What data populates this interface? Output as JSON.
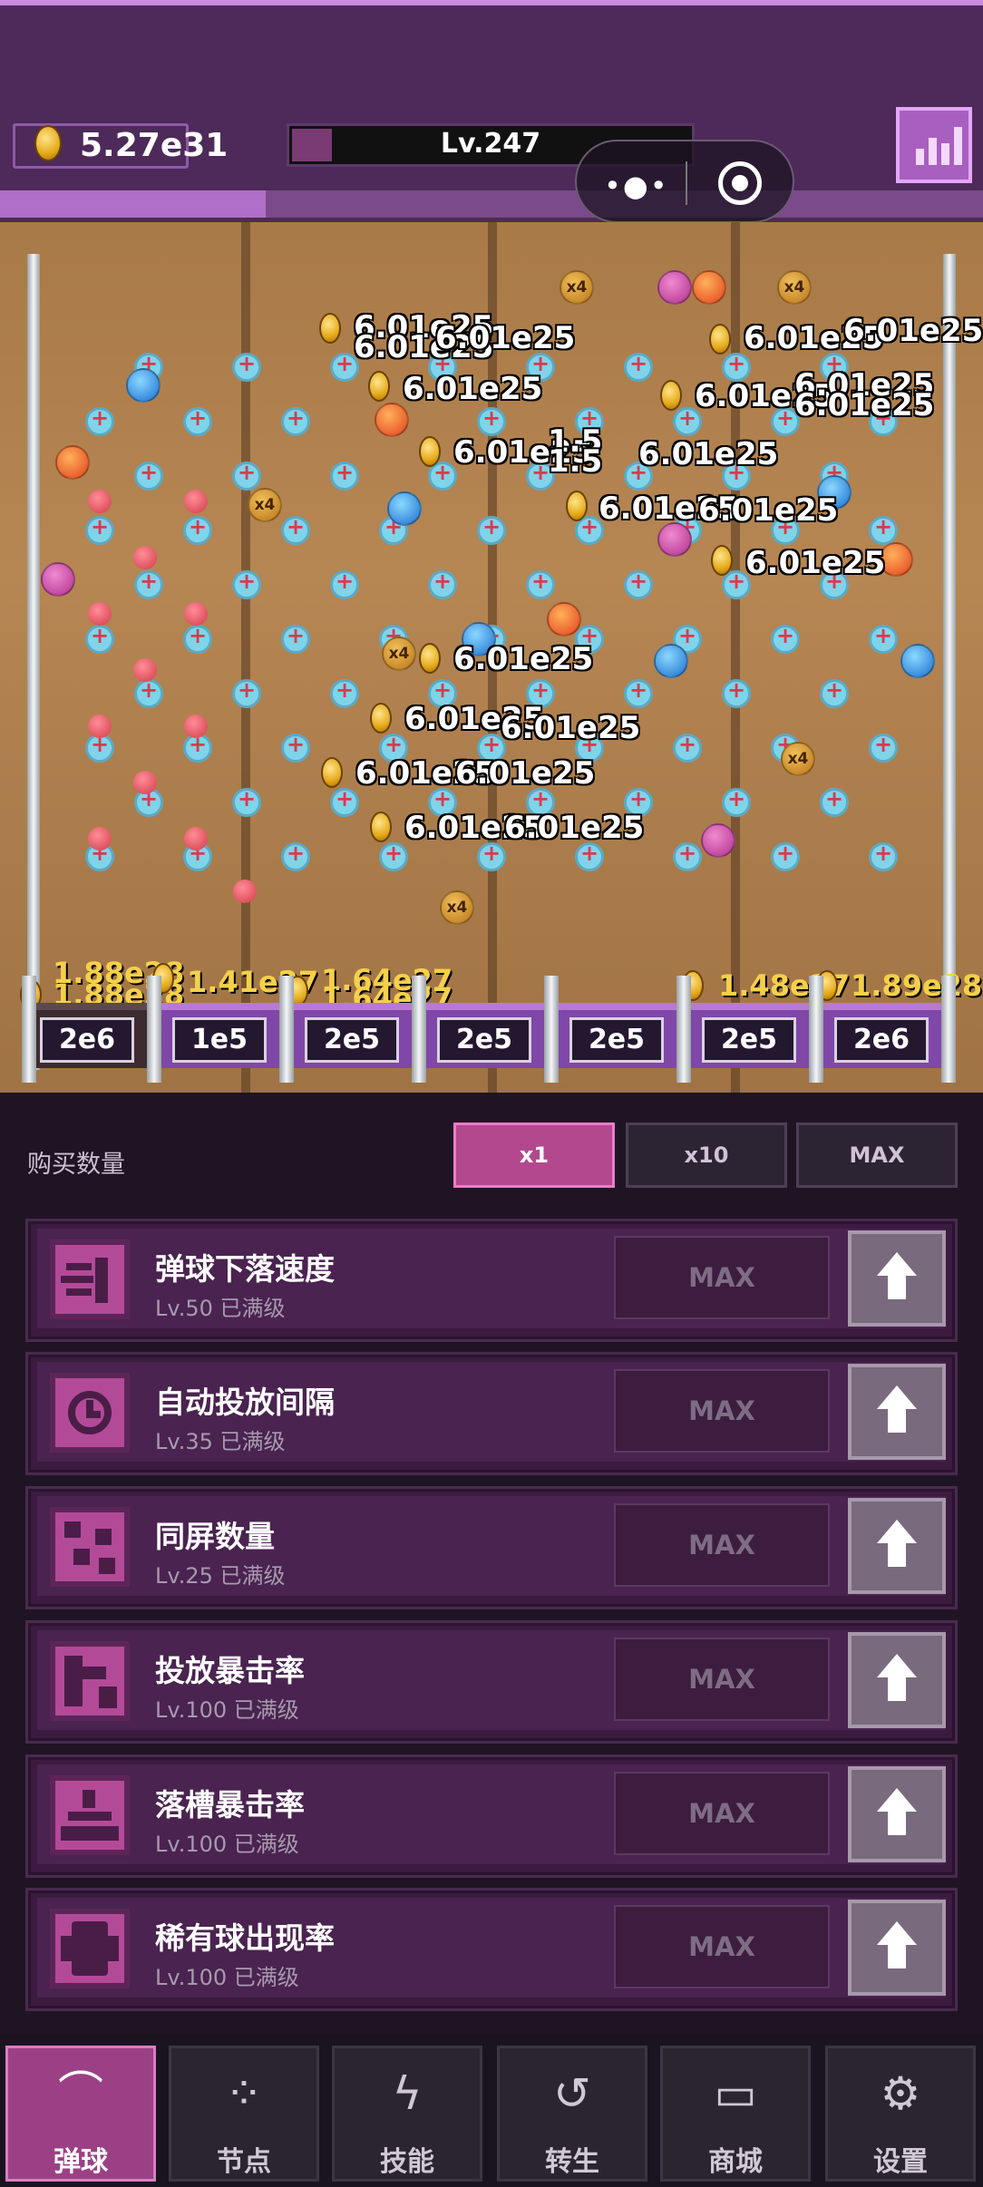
{
  "hud": {
    "coins": "5.27e31",
    "level": "Lv.247",
    "level_progress": 0.1,
    "xp_progress": 0.27
  },
  "board": {
    "popups": [
      "6.01e25",
      "6.01e25",
      "6.01e25",
      "6.01e25",
      "6.01e25",
      "6.01e25",
      "6.01e25",
      "6.01e25",
      "6.01e25",
      "6.01e25",
      "6.01e25",
      "6.01e25",
      "6.01e25",
      "6.01e25",
      "6.01e25",
      "6.01e25",
      "6.01e25",
      "6.01e25",
      "1.5",
      "1.5"
    ],
    "orb_multiplier": "x4",
    "slot_gains": [
      "1.88e28",
      "1.88e28",
      "1.41e27",
      "1.64e27",
      "1.64e27",
      "1.48e27",
      "1.89e28"
    ],
    "bins": [
      "2e6",
      "1e5",
      "2e5",
      "2e5",
      "2e5",
      "2e5",
      "2e6"
    ]
  },
  "purchase": {
    "label": "购买数量",
    "options": [
      "x1",
      "x10",
      "MAX"
    ],
    "selected": "x1"
  },
  "upgrades": [
    {
      "title": "弹球下落速度",
      "sub": "Lv.50  已满级",
      "status": "MAX"
    },
    {
      "title": "自动投放间隔",
      "sub": "Lv.35  已满级",
      "status": "MAX"
    },
    {
      "title": "同屏数量",
      "sub": "Lv.25  已满级",
      "status": "MAX"
    },
    {
      "title": "投放暴击率",
      "sub": "Lv.100  已满级",
      "status": "MAX"
    },
    {
      "title": "落槽暴击率",
      "sub": "Lv.100  已满级",
      "status": "MAX"
    },
    {
      "title": "稀有球出现率",
      "sub": "Lv.100  已满级",
      "status": "MAX"
    }
  ],
  "nav": [
    {
      "label": "弹球",
      "icon": "pinball-icon",
      "active": true
    },
    {
      "label": "节点",
      "icon": "nodes-icon"
    },
    {
      "label": "技能",
      "icon": "lightning-icon"
    },
    {
      "label": "转生",
      "icon": "rebirth-icon"
    },
    {
      "label": "商城",
      "icon": "shop-icon"
    },
    {
      "label": "设置",
      "icon": "gear-icon"
    }
  ],
  "colors": {
    "accent": "#b3488f",
    "panel": "#1f1424",
    "card": "#4a2350",
    "bin": "#7f47a8",
    "gain_text": "#f5d04a"
  }
}
